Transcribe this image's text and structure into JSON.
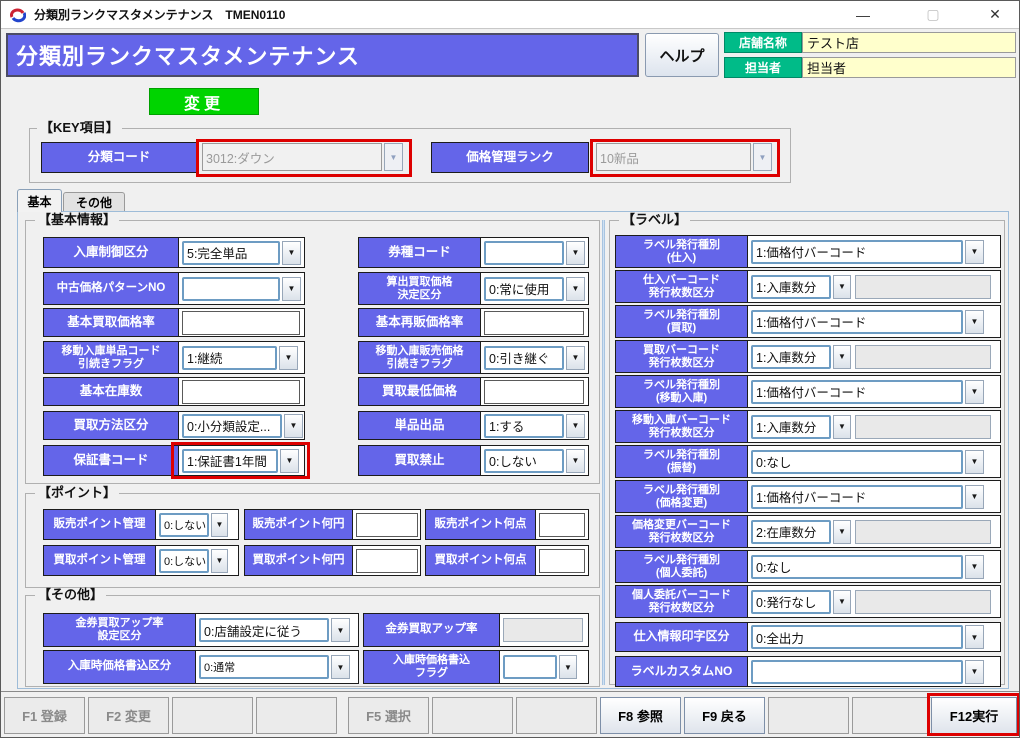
{
  "window": {
    "title": "分類別ランクマスタメンテナンス　TMEN0110"
  },
  "icons": {
    "dropdown": "▼",
    "minimize": "—",
    "maximize": "▢",
    "close": "✕"
  },
  "colors": {
    "accent_blue": "#6465e9",
    "label_green": "#00bb88",
    "action_green": "#00d400",
    "highlight_red": "#dd0000",
    "value_cream": "#ffffcc"
  },
  "header": {
    "banner": "分類別ランクマスタメンテナンス",
    "help": "ヘルプ",
    "store_label": "店舗名称",
    "store_value": "テスト店",
    "person_label": "担当者",
    "person_value": "担当者",
    "mode": "変更"
  },
  "key": {
    "title": "【KEY項目】",
    "fields": [
      {
        "label": "分類コード",
        "value": "3012:ダウン"
      },
      {
        "label": "価格管理ランク",
        "value": "10新品"
      }
    ]
  },
  "tabs": [
    {
      "label": "基本"
    },
    {
      "label": "その他"
    }
  ],
  "basic": {
    "title": "【基本情報】",
    "rows": [
      {
        "l_label": "入庫制御区分",
        "l_value": "5:完全単品",
        "r_label": "券種コード",
        "r_value": ""
      },
      {
        "l_label": "中古価格パターンNO",
        "l_value": "",
        "r_label": "算出買取価格\n決定区分",
        "r_value": "0:常に使用"
      },
      {
        "l_label": "基本買取価格率",
        "l_value": "",
        "r_label": "基本再販価格率",
        "r_value": ""
      },
      {
        "l_label": "移動入庫単品コード\n引続きフラグ",
        "l_value": "1:継続",
        "r_label": "移動入庫販売価格\n引続きフラグ",
        "r_value": "0:引き継ぐ"
      },
      {
        "l_label": "基本在庫数",
        "l_value": "",
        "r_label": "買取最低価格",
        "r_value": ""
      },
      {
        "l_label": "買取方法区分",
        "l_value": "0:小分類設定...",
        "r_label": "単品出品",
        "r_value": "1:する"
      },
      {
        "l_label": "保証書コード",
        "l_value": "1:保証書1年間",
        "r_label": "買取禁止",
        "r_value": "0:しない"
      }
    ]
  },
  "points": {
    "title": "【ポイント】",
    "rows": [
      {
        "m_label": "販売ポイント管理",
        "m_value": "0:しない",
        "yen_label": "販売ポイント何円",
        "yen_value": "",
        "pt_label": "販売ポイント何点",
        "pt_value": ""
      },
      {
        "m_label": "買取ポイント管理",
        "m_value": "0:しない",
        "yen_label": "買取ポイント何円",
        "yen_value": "",
        "pt_label": "買取ポイント何点",
        "pt_value": ""
      }
    ]
  },
  "others": {
    "title": "【その他】",
    "s1_label": "金券買取アップ率\n設定区分",
    "s1_value": "0:店舗設定に従う",
    "s1b_label": "金券買取アップ率",
    "s1b_value": "",
    "s2_label": "入庫時価格書込区分",
    "s2_value": "0:通常",
    "s2b_label": "入庫時価格書込\nフラグ",
    "s2b_value": ""
  },
  "labels": {
    "title": "【ラベル】",
    "rows": [
      {
        "label": "ラベル発行種別\n(仕入)",
        "value": "1:価格付バーコード"
      },
      {
        "label": "仕入バーコード\n発行枚数区分",
        "value": "1:入庫数分",
        "aux": ""
      },
      {
        "label": "ラベル発行種別\n(買取)",
        "value": "1:価格付バーコード"
      },
      {
        "label": "買取バーコード\n発行枚数区分",
        "value": "1:入庫数分",
        "aux": ""
      },
      {
        "label": "ラベル発行種別\n(移動入庫)",
        "value": "1:価格付バーコード"
      },
      {
        "label": "移動入庫バーコード\n発行枚数区分",
        "value": "1:入庫数分",
        "aux": ""
      },
      {
        "label": "ラベル発行種別\n(振替)",
        "value": "0:なし"
      },
      {
        "label": "ラベル発行種別\n(価格変更)",
        "value": "1:価格付バーコード"
      },
      {
        "label": "価格変更バーコード\n発行枚数区分",
        "value": "2:在庫数分",
        "aux": ""
      },
      {
        "label": "ラベル発行種別\n(個人委託)",
        "value": "0:なし"
      },
      {
        "label": "個人委託バーコード\n発行枚数区分",
        "value": "0:発行なし",
        "aux": ""
      },
      {
        "label": "仕入情報印字区分",
        "value": "0:全出力"
      },
      {
        "label": "ラベルカスタムNO",
        "value": ""
      }
    ]
  },
  "fkeys": [
    {
      "label": "F1 登録"
    },
    {
      "label": "F2 変更"
    },
    {
      "label": ""
    },
    {
      "label": ""
    },
    {
      "label": "F5 選択"
    },
    {
      "label": ""
    },
    {
      "label": ""
    },
    {
      "label": "F8 参照"
    },
    {
      "label": "F9 戻る"
    },
    {
      "label": ""
    },
    {
      "label": ""
    },
    {
      "label": "F12実行"
    }
  ]
}
